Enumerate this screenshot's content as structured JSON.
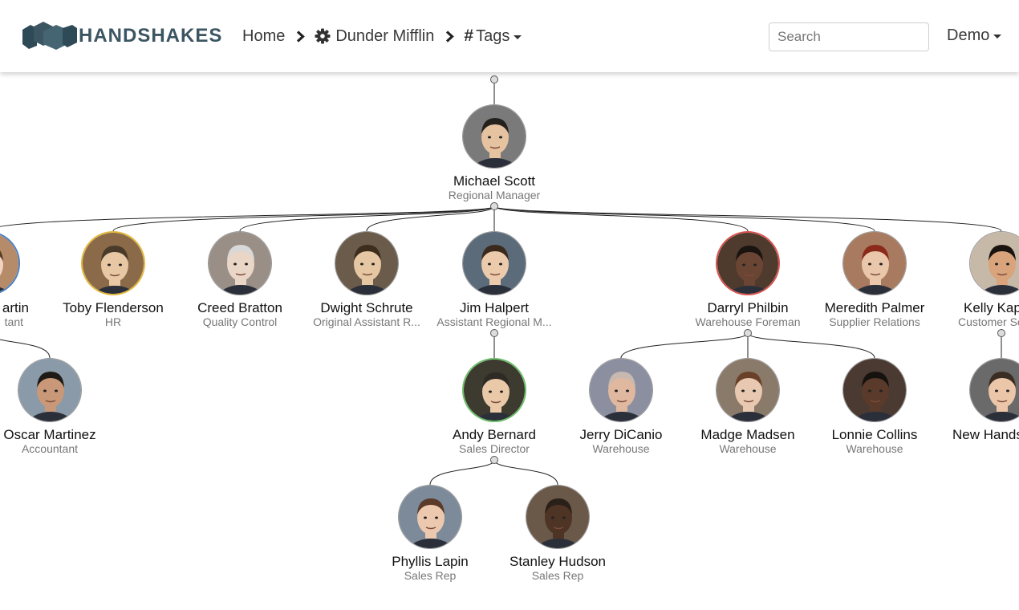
{
  "header": {
    "brand": "HANDSHAKES",
    "brand_icon": "handshakes-logo-icon",
    "breadcrumb": [
      {
        "label": "Home",
        "icon": ""
      },
      {
        "label": "Dunder Mifflin",
        "icon": "gear-icon"
      },
      {
        "label": "Tags",
        "icon": "hash-icon",
        "dropdown": true
      }
    ],
    "search_placeholder": "Search",
    "user_menu": "Demo"
  },
  "colors": {
    "brand": "#3b5562",
    "line": "#222222",
    "border_blue": "#4a7fc1",
    "border_yellow": "#e2b73a",
    "border_green": "#6cbf6a",
    "border_red": "#d9534f"
  },
  "people": [
    {
      "id": "angela",
      "name": "Angela Martin",
      "title": "Accountant",
      "display_name": "artin",
      "display_title": "tant",
      "border": "blue"
    },
    {
      "id": "toby",
      "name": "Toby Flenderson",
      "title": "HR",
      "border": "yellow"
    },
    {
      "id": "creed",
      "name": "Creed Bratton",
      "title": "Quality Control",
      "border": "none"
    },
    {
      "id": "dwight",
      "name": "Dwight Schrute",
      "title": "Original Assistant R...",
      "border": "none"
    },
    {
      "id": "jim",
      "name": "Jim Halpert",
      "title": "Assistant Regional M...",
      "border": "none"
    },
    {
      "id": "darryl",
      "name": "Darryl Philbin",
      "title": "Warehouse Foreman",
      "border": "red"
    },
    {
      "id": "meredith",
      "name": "Meredith Palmer",
      "title": "Supplier Relations",
      "border": "none"
    },
    {
      "id": "kelly",
      "name": "Kelly Kapoor",
      "title": "Customer Service",
      "display_name": "Kelly Kap",
      "display_title": "Customer Se",
      "border": "none"
    },
    {
      "id": "michael",
      "name": "Michael Scott",
      "title": "Regional Manager",
      "border": "none"
    },
    {
      "id": "oscar",
      "name": "Oscar Martinez",
      "title": "Accountant",
      "border": "none"
    },
    {
      "id": "andy",
      "name": "Andy Bernard",
      "title": "Sales Director",
      "border": "green"
    },
    {
      "id": "jerry",
      "name": "Jerry DiCanio",
      "title": "Warehouse",
      "border": "none"
    },
    {
      "id": "madge",
      "name": "Madge Madsen",
      "title": "Warehouse",
      "border": "none"
    },
    {
      "id": "lonnie",
      "name": "Lonnie Collins",
      "title": "Warehouse",
      "border": "none"
    },
    {
      "id": "newhands",
      "name": "New Handshake",
      "title": "",
      "display_name": "New Hands",
      "border": "none"
    },
    {
      "id": "phyllis",
      "name": "Phyllis Lapin",
      "title": "Sales Rep",
      "border": "none"
    },
    {
      "id": "stanley",
      "name": "Stanley Hudson",
      "title": "Sales Rep",
      "border": "none"
    }
  ],
  "reports": {
    "michael": [
      "angela",
      "toby",
      "creed",
      "dwight",
      "jim",
      "darryl",
      "meredith",
      "kelly"
    ],
    "angela": [
      "oscar"
    ],
    "jim": [
      "andy"
    ],
    "darryl": [
      "jerry",
      "madge",
      "lonnie"
    ],
    "kelly": [
      "newhands"
    ],
    "andy": [
      "phyllis",
      "stanley"
    ]
  }
}
